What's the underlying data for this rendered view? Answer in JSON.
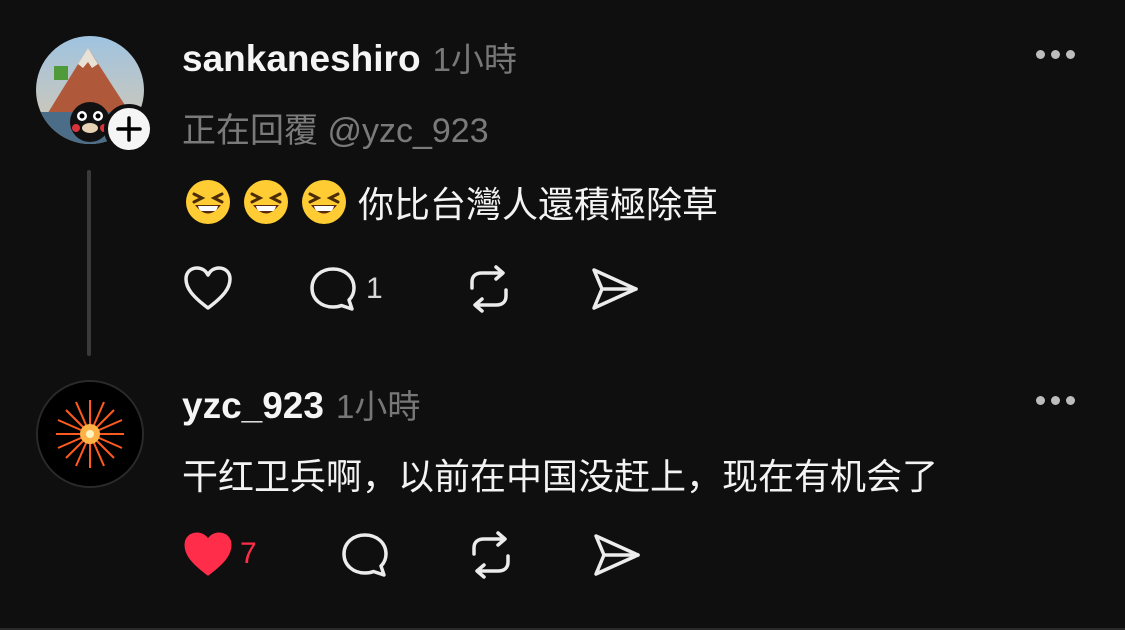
{
  "posts": [
    {
      "username": "sankaneshiro",
      "timestamp": "1小時",
      "reply_to": "正在回覆 @yzc_923",
      "body": "你比台灣人還積極除草",
      "emojis": [
        "grinning-squinting-face",
        "grinning-squinting-face",
        "grinning-squinting-face"
      ],
      "reply_count": "1",
      "liked": false
    },
    {
      "username": "yzc_923",
      "timestamp": "1小時",
      "body": "干红卫兵啊，以前在中国没赶上，现在有机会了",
      "like_count": "7",
      "liked": true
    }
  ],
  "colors": {
    "background": "#0f0f0f",
    "like_active": "#ff2d4a",
    "muted_text": "#777777"
  }
}
